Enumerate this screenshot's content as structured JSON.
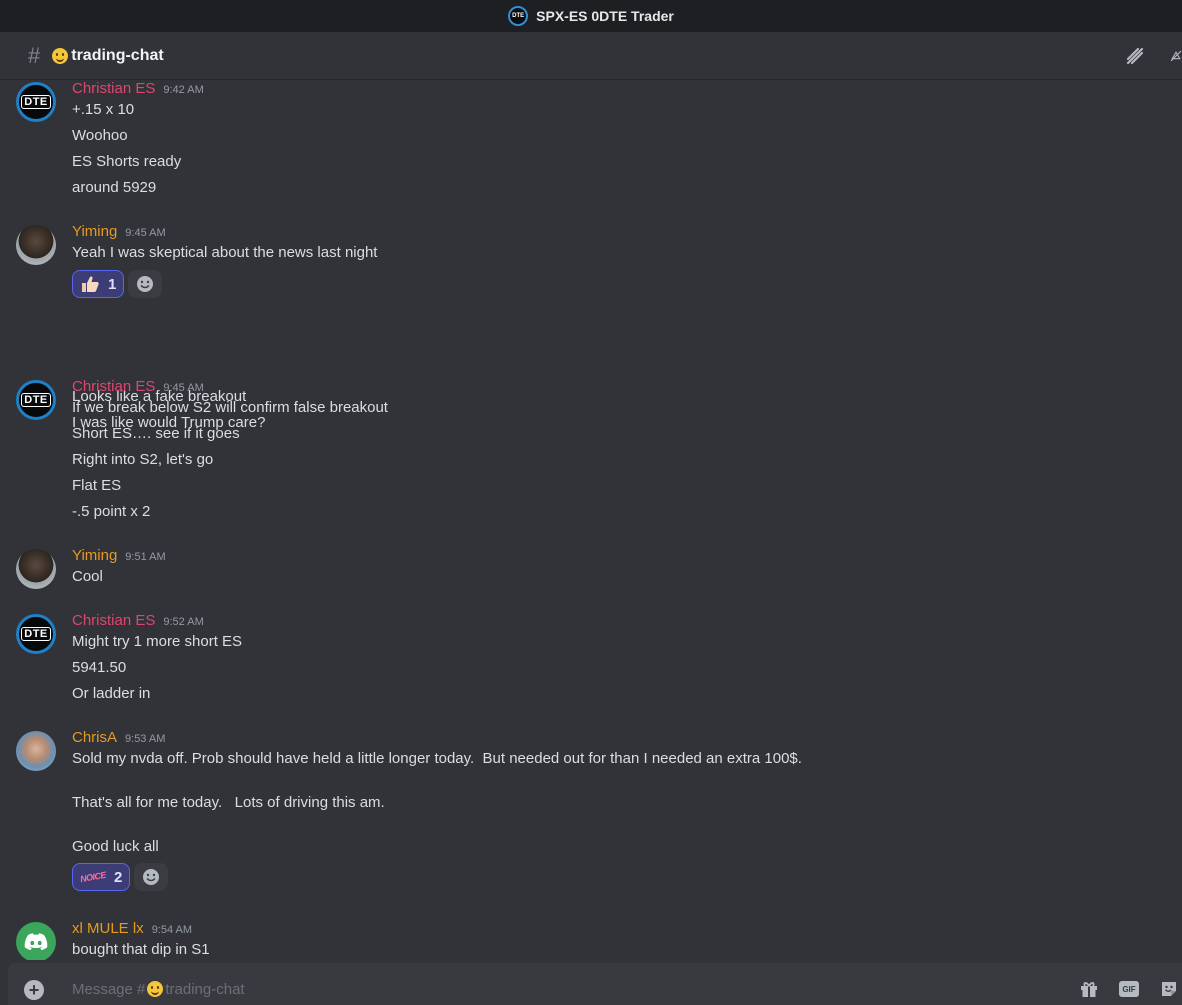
{
  "window": {
    "title": "SPX-ES 0DTE Trader",
    "server_icon_text": "DTE"
  },
  "channel": {
    "name": "trading-chat",
    "emoji": "grinning-face-icon"
  },
  "colors": {
    "pink_author": "#e0456e",
    "gold_author": "#e69b1f",
    "reaction_bg": "#3b3d74",
    "bg": "#313338"
  },
  "messages": [
    {
      "author": "Christian ES",
      "time": "9:42 AM",
      "lines": [
        "+.15 x 10",
        "Woohoo",
        "ES Shorts ready",
        "around 5929"
      ]
    },
    {
      "author": "Yiming",
      "time": "9:45 AM",
      "lines": [
        "Yeah I was skeptical about the news last night"
      ],
      "reaction": {
        "emoji": "thumbs-up-icon",
        "count": "1"
      },
      "lines_after": [
        "Looks like a fake breakout",
        "I was like would Trump care?"
      ]
    },
    {
      "author": "Christian ES",
      "time": "9:45 AM",
      "lines": [
        "If we break below S2 will confirm false breakout",
        "Short ES…. see if it goes",
        "Right into S2, let's go",
        "Flat ES",
        "-.5 point x 2"
      ]
    },
    {
      "author": "Yiming",
      "time": "9:51 AM",
      "lines": [
        "Cool"
      ]
    },
    {
      "author": "Christian ES",
      "time": "9:52 AM",
      "lines": [
        "Might try 1 more short ES",
        "5941.50",
        "Or ladder in"
      ]
    },
    {
      "author": "ChrisA",
      "time": "9:53 AM",
      "lines": [
        "Sold my nvda off. Prob should have held a little longer today.  But needed out for than I needed an extra 100$.",
        "That's all for me today.   Lots of driving this am.",
        "Good luck all"
      ],
      "reaction": {
        "emoji": "noice-icon",
        "emoji_text": "NOICE",
        "count": "2"
      }
    },
    {
      "author": "xl MULE lx",
      "time": "9:54 AM",
      "lines": [
        "bought that dip in S1"
      ]
    }
  ],
  "composer": {
    "placeholder_prefix": "Message #",
    "channel_name": "trading-chat"
  }
}
